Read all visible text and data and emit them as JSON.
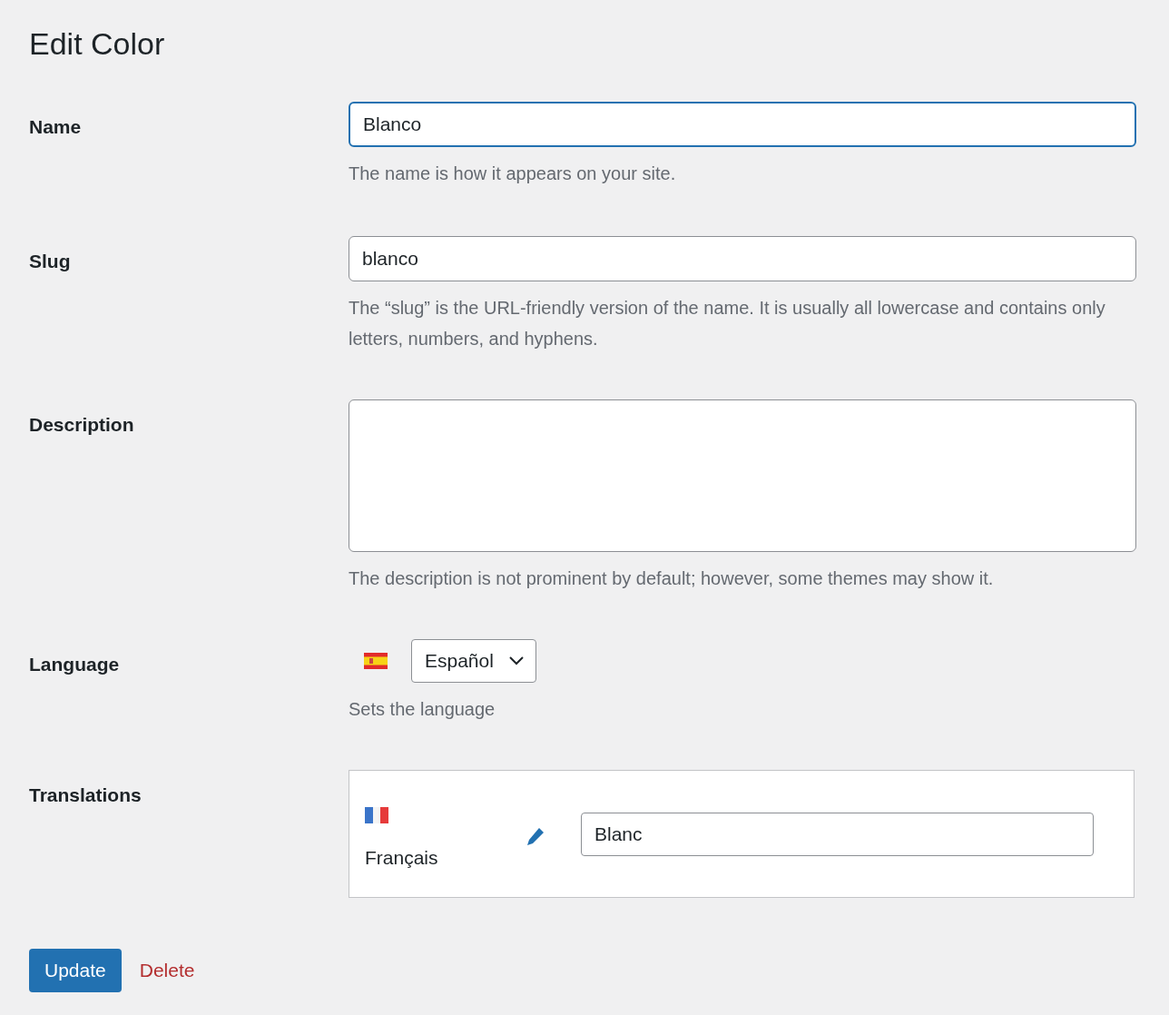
{
  "title": "Edit Color",
  "fields": [
    {
      "kind": "input",
      "label": "Name",
      "value": "Blanco",
      "focused": true,
      "help": "The name is how it appears on your site."
    },
    {
      "kind": "input",
      "label": "Slug",
      "value": "blanco",
      "focused": false,
      "help": "The “slug” is the URL-friendly version of the name. It is usually all lowercase and contains only letters, numbers, and hyphens."
    },
    {
      "kind": "textarea",
      "label": "Description",
      "focused": false,
      "help": "The description is not prominent by default; however, some themes may show it."
    },
    {
      "kind": "language",
      "label": "Language",
      "flag": {
        "kind": "es"
      },
      "value": "Español",
      "help": "Sets the language"
    },
    {
      "kind": "translations",
      "label": "Translations",
      "items": [
        {
          "flag": {
            "kind": "fr"
          },
          "language": "Français",
          "value": "Blanc"
        }
      ]
    }
  ],
  "buttons": [
    {
      "kind": "primary",
      "label": "Update"
    },
    {
      "kind": "link",
      "label": "Delete"
    }
  ]
}
